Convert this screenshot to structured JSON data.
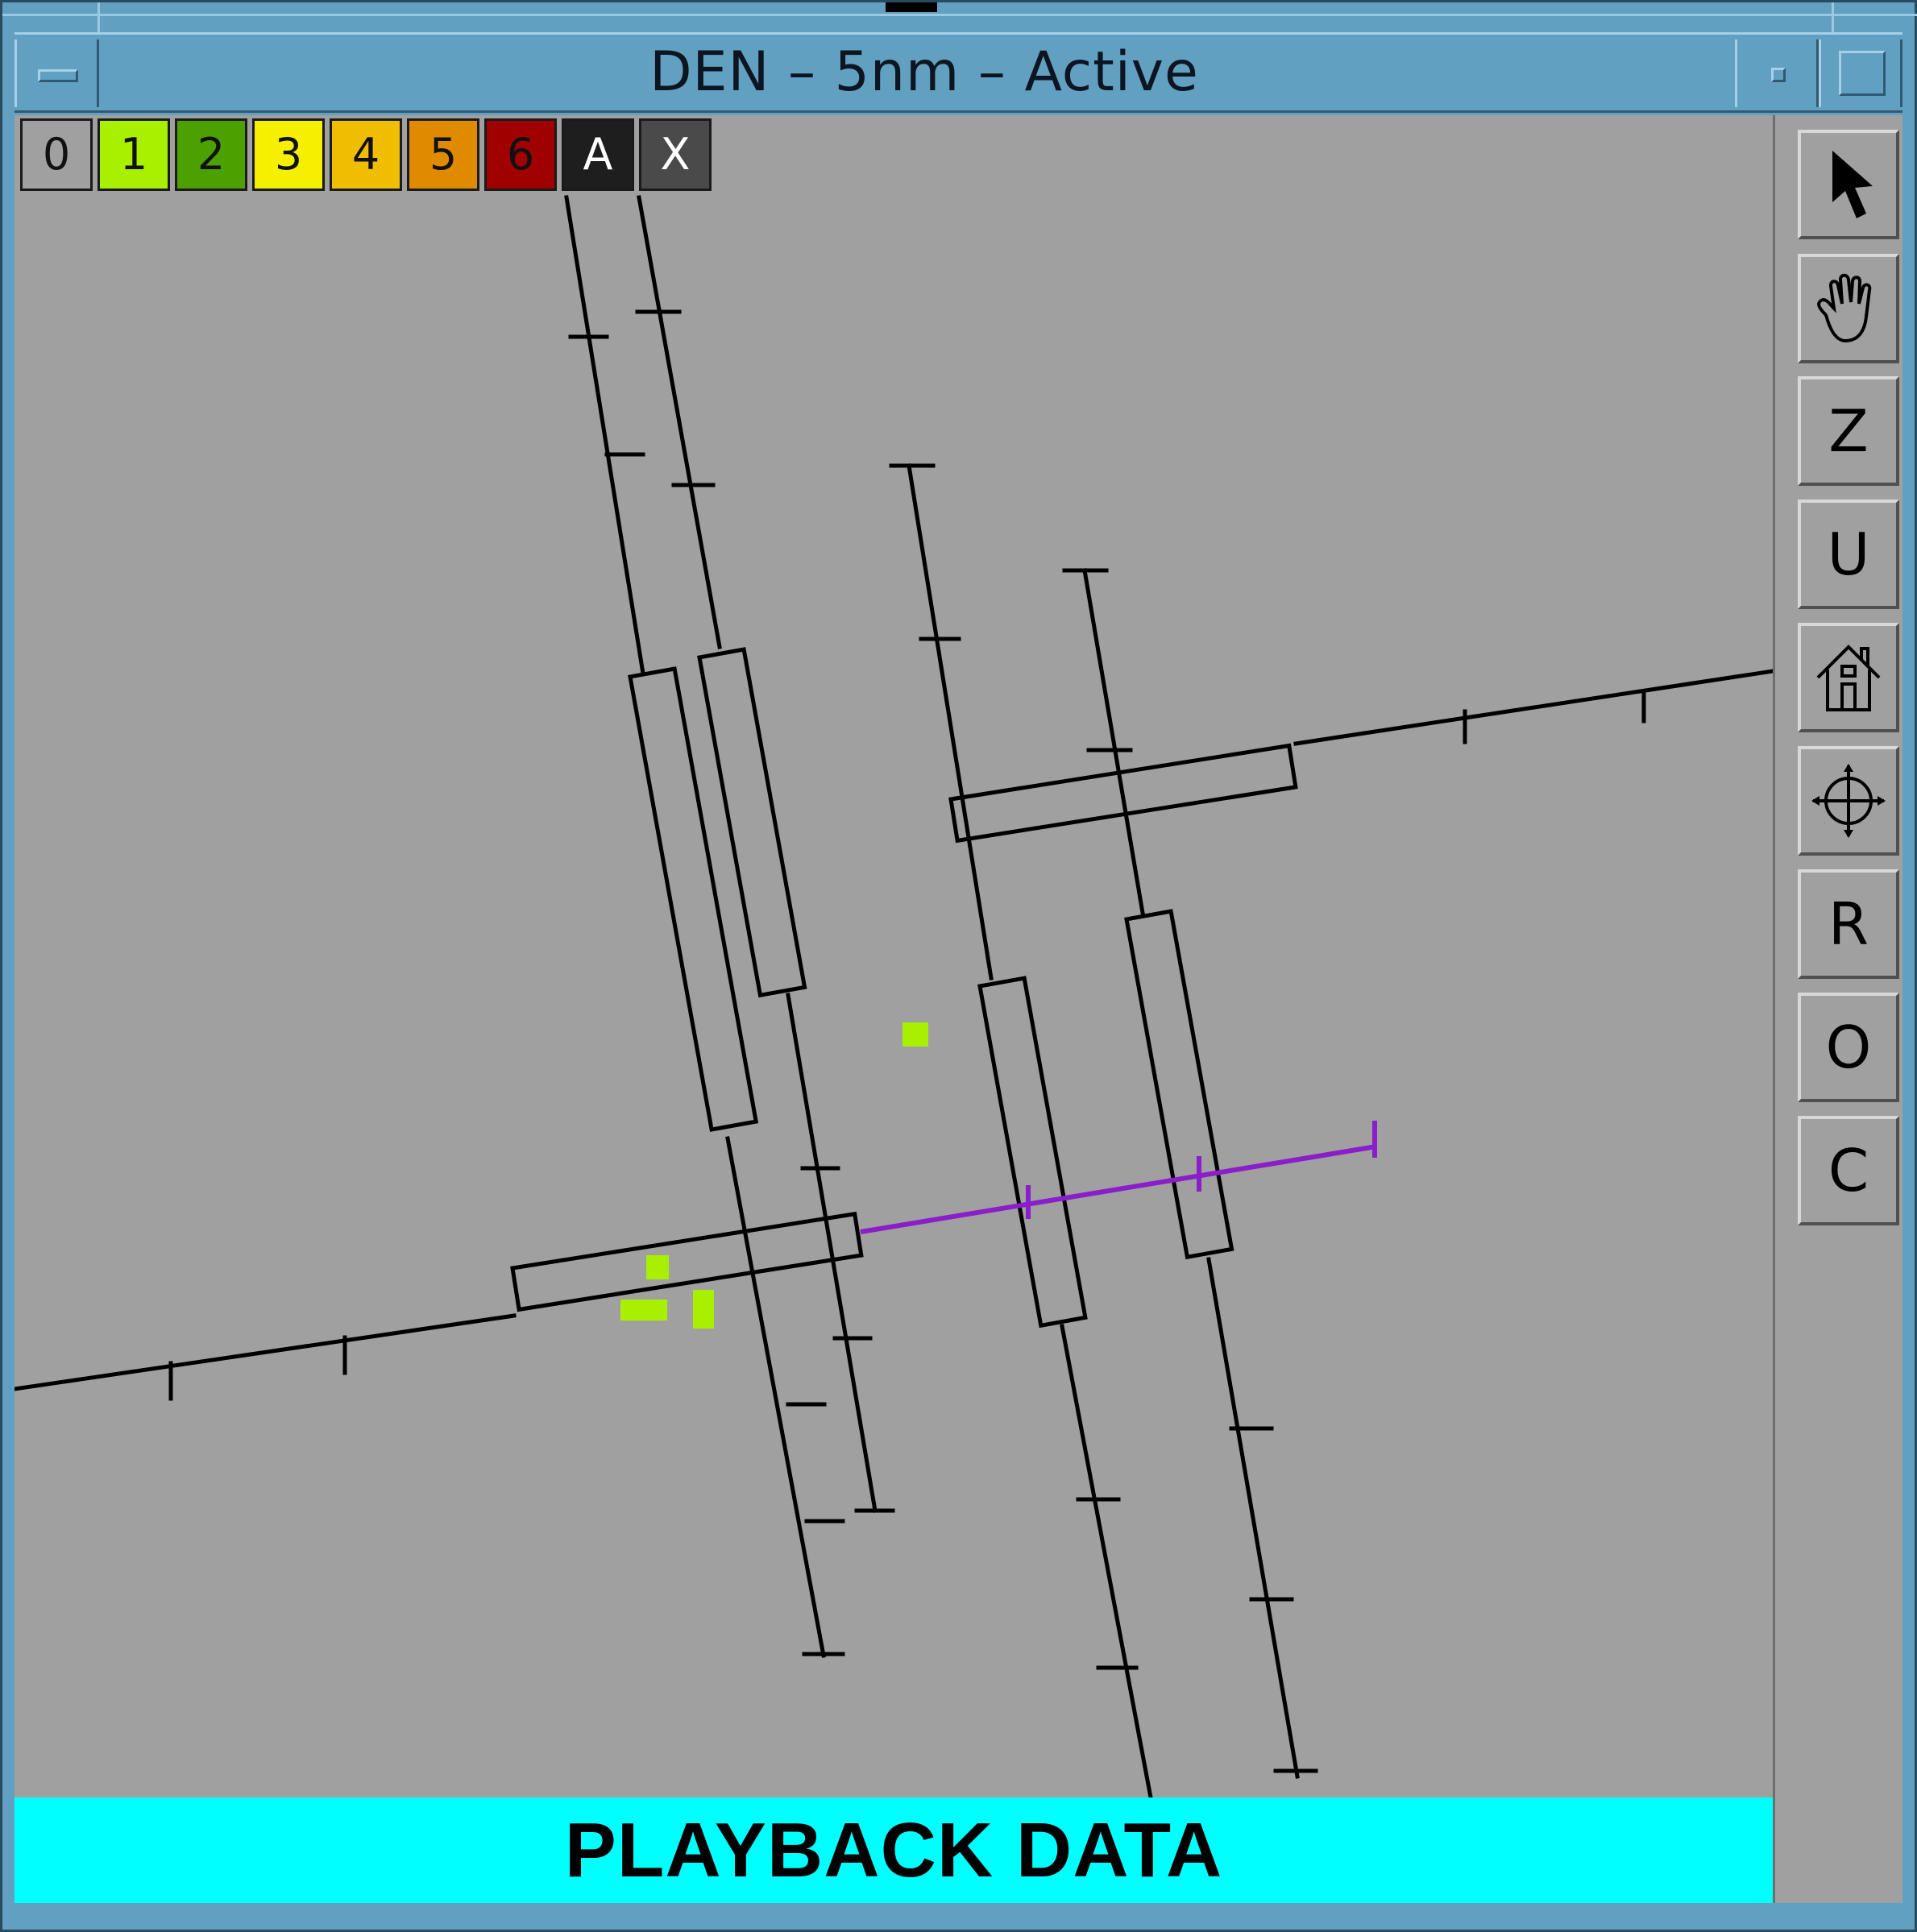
{
  "window": {
    "title": "DEN – 5nm – Active"
  },
  "level_filters": [
    {
      "label": "0",
      "color": "#a0a0a0",
      "text_color": "#111111"
    },
    {
      "label": "1",
      "color": "#a8f000",
      "text_color": "#111111"
    },
    {
      "label": "2",
      "color": "#4ca000",
      "text_color": "#111111"
    },
    {
      "label": "3",
      "color": "#f5f000",
      "text_color": "#111111"
    },
    {
      "label": "4",
      "color": "#f0be00",
      "text_color": "#111111"
    },
    {
      "label": "5",
      "color": "#e08a00",
      "text_color": "#111111"
    },
    {
      "label": "6",
      "color": "#a00000",
      "text_color": "#111111"
    },
    {
      "label": "A",
      "color": "#1e1e1e",
      "text_color": "#ffffff"
    },
    {
      "label": "X",
      "color": "#4a4a4a",
      "text_color": "#ffffff"
    }
  ],
  "toolbar": {
    "tools": [
      {
        "icon": "arrow-pointer-icon",
        "label": ""
      },
      {
        "icon": "hand-pan-icon",
        "label": ""
      },
      {
        "icon": "zoom-icon",
        "label": "Z"
      },
      {
        "icon": "unzoom-icon",
        "label": "U"
      },
      {
        "icon": "home-icon",
        "label": ""
      },
      {
        "icon": "crosshair-icon",
        "label": ""
      },
      {
        "icon": "r-icon",
        "label": "R"
      },
      {
        "icon": "o-icon",
        "label": "O"
      },
      {
        "icon": "c-icon",
        "label": "C"
      }
    ]
  },
  "banner": {
    "text": "PLAYBACK DATA"
  },
  "colors": {
    "map_background": "#a0a0a0",
    "runway_lines": "#000000",
    "active_approach": "#8a1ec8",
    "weather_cells": "#a8f000",
    "banner_background": "#00ffff"
  }
}
